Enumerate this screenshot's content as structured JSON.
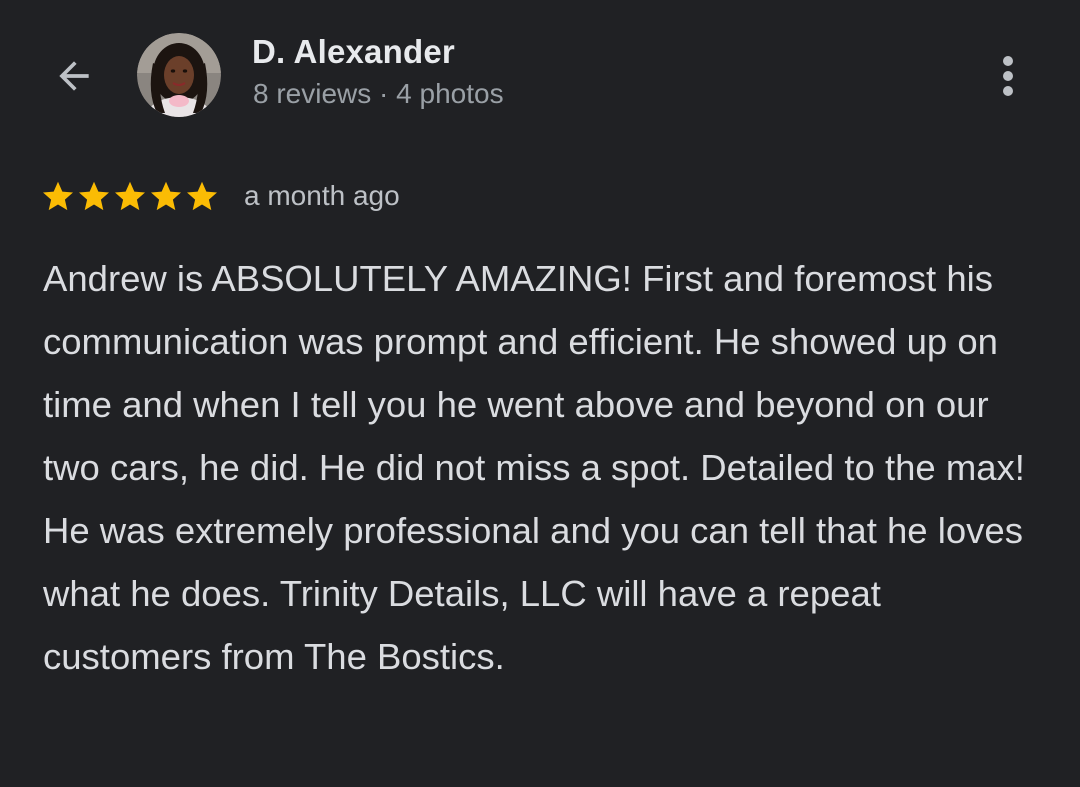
{
  "header": {
    "reviewer_name": "D. Alexander",
    "reviewer_meta": "8 reviews · 4 photos",
    "back_icon": "arrow-back-icon",
    "more_icon": "more-vert-icon"
  },
  "review": {
    "rating": 5,
    "rating_max": 5,
    "star_color": "#fbbc04",
    "timestamp": "a month ago",
    "text": "Andrew is ABSOLUTELY AMAZING! First and foremost his communication was prompt and efficient. He showed up on time and when I tell you he went above and beyond on our two cars, he did. He did not miss a spot. Detailed to the max! He was extremely professional and you can tell that he loves what he does. Trinity Details, LLC will have a repeat customers from The Bostics."
  },
  "colors": {
    "background": "#202124",
    "primary_text": "#e8eaed",
    "secondary_text": "#9aa0a6"
  }
}
